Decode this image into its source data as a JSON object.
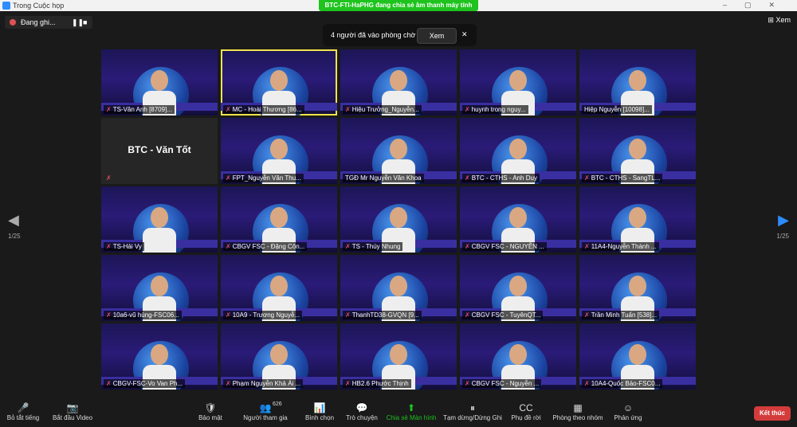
{
  "titlebar": {
    "title": "Trong Cuộc họp",
    "share_banner": "BTC-FTI-HaPHG đang chia sẻ âm thanh máy tính"
  },
  "recording": {
    "label": "Đang ghi...",
    "pause_icon": "❚❚",
    "stop_icon": "■"
  },
  "view": {
    "label": "Xem",
    "icon": "⊞"
  },
  "waiting_room": {
    "text": "4 người đã vào phòng chờ",
    "button": "Xem",
    "close": "✕"
  },
  "pagination": {
    "left_arrow": "◀",
    "right_arrow": "▶",
    "left_page": "1/25",
    "right_page": "1/25"
  },
  "tiles": [
    {
      "name": "TS-Văn Anh [8709]...",
      "muted": true,
      "type": "video"
    },
    {
      "name": "MC - Hoài Thương [86...",
      "muted": true,
      "type": "video",
      "selected": true
    },
    {
      "name": "Hiệu Trưởng_Nguyễn...",
      "muted": true,
      "type": "video"
    },
    {
      "name": "huynh trong nguy...",
      "muted": true,
      "type": "video"
    },
    {
      "name": "Hiệp Nguyễn [10098]...",
      "muted": false,
      "type": "video"
    },
    {
      "name": "",
      "big": "BTC - Văn Tốt",
      "muted": true,
      "type": "plain"
    },
    {
      "name": "FPT_Nguyễn Văn Thu...",
      "muted": true,
      "type": "video"
    },
    {
      "name": "TGĐ Mr Nguyễn Văn Khoa",
      "muted": false,
      "type": "video"
    },
    {
      "name": "BTC - CTHS - Anh Duy",
      "muted": true,
      "type": "video"
    },
    {
      "name": "BTC - CTHS - SangTL...",
      "muted": true,
      "type": "video"
    },
    {
      "name": "TS-Hải Vy",
      "muted": true,
      "type": "video"
    },
    {
      "name": "CBGV FSC - Đặng Côn...",
      "muted": true,
      "type": "video"
    },
    {
      "name": "TS - Thúy Nhung",
      "muted": true,
      "type": "video"
    },
    {
      "name": "CBGV FSC - NGUYỄN ...",
      "muted": true,
      "type": "video"
    },
    {
      "name": "11A4-Nguyễn Thành ...",
      "muted": true,
      "type": "video"
    },
    {
      "name": "10a6-vũ hùng-FSC06...",
      "muted": true,
      "type": "video"
    },
    {
      "name": "10A9 - Trương Nguyễ...",
      "muted": true,
      "type": "video"
    },
    {
      "name": "ThanhTD38-GVQN [9...",
      "muted": true,
      "type": "video"
    },
    {
      "name": "CBGV FSC - TuyênQT...",
      "muted": true,
      "type": "video"
    },
    {
      "name": "Trần Minh Tuấn [538]...",
      "muted": true,
      "type": "video"
    },
    {
      "name": "CBGV-FSC-Vo Van Ph...",
      "muted": true,
      "type": "video"
    },
    {
      "name": "Phạm Nguyễn Khả Ái ...",
      "muted": true,
      "type": "video"
    },
    {
      "name": "HB2.6 Phước Thịnh",
      "muted": true,
      "type": "video"
    },
    {
      "name": "CBGV FSC - Nguyễn ...",
      "muted": true,
      "type": "video"
    },
    {
      "name": "10A4-Quốc Bảo-FSC0...",
      "muted": true,
      "type": "video"
    }
  ],
  "toolbar": {
    "items": [
      {
        "label": "Bỏ tắt tiếng",
        "icon": "🎤"
      },
      {
        "label": "Bắt đầu Video",
        "icon": "📷"
      },
      {
        "label": "Bảo mật",
        "icon": "🛡"
      },
      {
        "label": "Người tham gia",
        "icon": "👥",
        "count": "626"
      },
      {
        "label": "Bình chọn",
        "icon": "📊"
      },
      {
        "label": "Trò chuyện",
        "icon": "💬"
      },
      {
        "label": "Chia sẻ Màn hình",
        "icon": "⬆"
      },
      {
        "label": "Tạm dừng/Dừng Ghi",
        "icon": "⏸"
      },
      {
        "label": "Phụ đề rời",
        "icon": "CC"
      },
      {
        "label": "Phòng theo nhóm",
        "icon": "▦"
      },
      {
        "label": "Phản ứng",
        "icon": "☺"
      }
    ],
    "end": "Kết thúc"
  },
  "colors": {
    "share_green": "#1ec31e",
    "end_red": "#d43c3c",
    "accent_blue": "#2d8cff",
    "selected_yellow": "#f0e34a"
  }
}
